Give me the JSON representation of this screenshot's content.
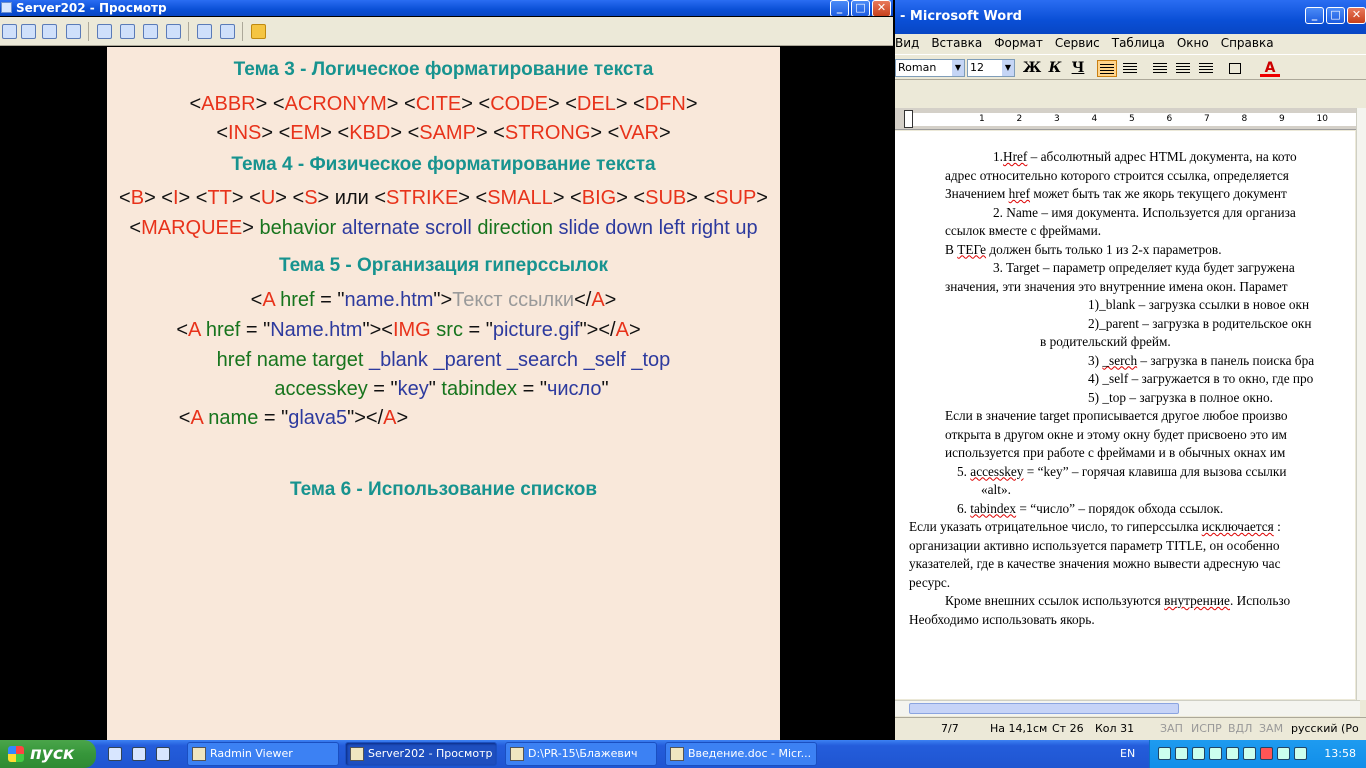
{
  "left_window": {
    "title": "Server202 - Просмотр",
    "controls": {
      "minimize": "_",
      "maximize": "□",
      "close": "✕"
    },
    "slide": {
      "lines": [
        {
          "kind": "head",
          "parts": [
            {
              "t": "Тема 3 - Логическое форматирование текста",
              "c": "head"
            }
          ]
        },
        {
          "kind": "code",
          "parts": [
            {
              "t": "<",
              "c": "k"
            },
            {
              "t": "ABBR",
              "c": "r"
            },
            {
              "t": "> <",
              "c": "k"
            },
            {
              "t": "ACRONYM",
              "c": "r"
            },
            {
              "t": "> <",
              "c": "k"
            },
            {
              "t": "CITE",
              "c": "r"
            },
            {
              "t": "> <",
              "c": "k"
            },
            {
              "t": "CODE",
              "c": "r"
            },
            {
              "t": "> <",
              "c": "k"
            },
            {
              "t": "DEL",
              "c": "r"
            },
            {
              "t": "> <",
              "c": "k"
            },
            {
              "t": "DFN",
              "c": "r"
            },
            {
              "t": ">",
              "c": "k"
            }
          ]
        },
        {
          "kind": "code",
          "parts": [
            {
              "t": "<",
              "c": "k"
            },
            {
              "t": "INS",
              "c": "r"
            },
            {
              "t": "> <",
              "c": "k"
            },
            {
              "t": "EM",
              "c": "r"
            },
            {
              "t": "> <",
              "c": "k"
            },
            {
              "t": "KBD",
              "c": "r"
            },
            {
              "t": "> <",
              "c": "k"
            },
            {
              "t": "SAMP",
              "c": "r"
            },
            {
              "t": "> <",
              "c": "k"
            },
            {
              "t": "STRONG",
              "c": "r"
            },
            {
              "t": "> <",
              "c": "k"
            },
            {
              "t": "VAR",
              "c": "r"
            },
            {
              "t": ">",
              "c": "k"
            }
          ]
        },
        {
          "kind": "head",
          "parts": [
            {
              "t": "Тема 4 - Физическое форматирование текста",
              "c": "head"
            }
          ]
        },
        {
          "kind": "code",
          "parts": [
            {
              "t": "<",
              "c": "k"
            },
            {
              "t": "B",
              "c": "r"
            },
            {
              "t": "> <",
              "c": "k"
            },
            {
              "t": "I",
              "c": "r"
            },
            {
              "t": "> <",
              "c": "k"
            },
            {
              "t": "TT",
              "c": "r"
            },
            {
              "t": "> <",
              "c": "k"
            },
            {
              "t": "U",
              "c": "r"
            },
            {
              "t": "> <",
              "c": "k"
            },
            {
              "t": "S",
              "c": "r"
            },
            {
              "t": "> или <",
              "c": "k"
            },
            {
              "t": "STRIKE",
              "c": "r"
            },
            {
              "t": "> <",
              "c": "k"
            },
            {
              "t": "SMALL",
              "c": "r"
            },
            {
              "t": "> <",
              "c": "k"
            },
            {
              "t": "BIG",
              "c": "r"
            },
            {
              "t": "> <",
              "c": "k"
            },
            {
              "t": "SUB",
              "c": "r"
            },
            {
              "t": "> <",
              "c": "k"
            },
            {
              "t": "SUP",
              "c": "r"
            },
            {
              "t": ">",
              "c": "k"
            }
          ]
        },
        {
          "kind": "code",
          "parts": [
            {
              "t": "<",
              "c": "k"
            },
            {
              "t": "MARQUEE",
              "c": "r"
            },
            {
              "t": "> ",
              "c": "k"
            },
            {
              "t": "behavior ",
              "c": "g"
            },
            {
              "t": "alternate ",
              "c": "b"
            },
            {
              "t": "scroll ",
              "c": "b"
            },
            {
              "t": "direction ",
              "c": "g"
            },
            {
              "t": "slide ",
              "c": "b"
            },
            {
              "t": "down ",
              "c": "b"
            },
            {
              "t": "left ",
              "c": "b"
            },
            {
              "t": "right ",
              "c": "b"
            },
            {
              "t": "up",
              "c": "b"
            }
          ]
        },
        {
          "kind": "head",
          "parts": [
            {
              "t": "Тема 5 - Организация гиперссылок",
              "c": "head"
            }
          ]
        },
        {
          "kind": "code",
          "parts": [
            {
              "t": "<",
              "c": "k"
            },
            {
              "t": "A ",
              "c": "r"
            },
            {
              "t": "href",
              "c": "g"
            },
            {
              "t": " = \"",
              "c": "k"
            },
            {
              "t": "name.htm",
              "c": "b"
            },
            {
              "t": "\">",
              "c": "k"
            },
            {
              "t": "Текст ссылки",
              "c": "gy"
            },
            {
              "t": "</",
              "c": "k"
            },
            {
              "t": "A",
              "c": "r"
            },
            {
              "t": ">",
              "c": "k"
            }
          ]
        },
        {
          "kind": "code",
          "parts": [
            {
              "t": "<",
              "c": "k"
            },
            {
              "t": "A ",
              "c": "r"
            },
            {
              "t": "href",
              "c": "g"
            },
            {
              "t": " = \"",
              "c": "k"
            },
            {
              "t": "Name.htm",
              "c": "b"
            },
            {
              "t": "\"><",
              "c": "k"
            },
            {
              "t": "IMG ",
              "c": "r"
            },
            {
              "t": "src",
              "c": "g"
            },
            {
              "t": " = \"",
              "c": "k"
            },
            {
              "t": "picture.gif",
              "c": "b"
            },
            {
              "t": "\"></",
              "c": "k"
            },
            {
              "t": "A",
              "c": "r"
            },
            {
              "t": ">",
              "c": "k"
            }
          ]
        },
        {
          "kind": "code",
          "parts": [
            {
              "t": "href  name  target  ",
              "c": "g"
            },
            {
              "t": "_blank  _parent  _search  _self  _top",
              "c": "b"
            }
          ]
        },
        {
          "kind": "code",
          "parts": [
            {
              "t": "accesskey",
              "c": "g"
            },
            {
              "t": " = \"",
              "c": "k"
            },
            {
              "t": "key",
              "c": "b"
            },
            {
              "t": "\" ",
              "c": "k"
            },
            {
              "t": "tabindex",
              "c": "g"
            },
            {
              "t": " = \"",
              "c": "k"
            },
            {
              "t": "число",
              "c": "b"
            },
            {
              "t": "\"",
              "c": "k"
            }
          ]
        },
        {
          "kind": "code",
          "parts": [
            {
              "t": "<",
              "c": "k"
            },
            {
              "t": "A ",
              "c": "r"
            },
            {
              "t": "name",
              "c": "g"
            },
            {
              "t": " = \"",
              "c": "k"
            },
            {
              "t": "glava5",
              "c": "b"
            },
            {
              "t": "\"></",
              "c": "k"
            },
            {
              "t": "A",
              "c": "r"
            },
            {
              "t": ">",
              "c": "k"
            }
          ]
        },
        {
          "kind": "head",
          "parts": [
            {
              "t": "Тема 6 - Использование списков",
              "c": "head"
            }
          ]
        }
      ]
    }
  },
  "right_window": {
    "title": "- Microsoft Word",
    "controls": {
      "minimize": "_",
      "maximize": "□",
      "close": "✕"
    },
    "menu": [
      "Вид",
      "Вставка",
      "Формат",
      "Сервис",
      "Таблица",
      "Окно",
      "Справка"
    ],
    "font_name": "Roman",
    "font_size": "12",
    "format_buttons": {
      "bold": "Ж",
      "italic": "К",
      "underline": "Ч",
      "font_color": "A"
    },
    "ruler_numbers": [
      "1",
      "2",
      "3",
      "4",
      "5",
      "6",
      "7",
      "8",
      "9",
      "10"
    ],
    "document_lines": [
      [
        {
          "t": "1."
        },
        {
          "t": "Href",
          "u": true
        },
        {
          "t": " – абсолютный адрес HTML документа, на кото"
        }
      ],
      [
        {
          "t": "адрес относительно которого строится ссылка, определяется"
        }
      ],
      [
        {
          "t": "Значением "
        },
        {
          "t": "href",
          "u": true
        },
        {
          "t": " может быть так же якорь текущего документ"
        }
      ],
      [
        {
          "t": "2. Name – имя документа. Используется для организа"
        }
      ],
      [
        {
          "t": "ссылок вместе с фреймами."
        }
      ],
      [
        {
          "t": "В "
        },
        {
          "t": "ТЕГе",
          "u": true
        },
        {
          "t": " должен быть только 1 из 2-х параметров."
        }
      ],
      [
        {
          "t": "3. Target – параметр определяет куда будет загружена"
        }
      ],
      [
        {
          "t": "значения, эти значения это внутренние имена окон. Парамет"
        }
      ],
      [
        {
          "t": "1)_blank – загрузка ссылки в новое окн"
        }
      ],
      [
        {
          "t": "2)_parent – загрузка в родительское окн"
        }
      ],
      [
        {
          "t": "в родительский фрейм."
        }
      ],
      [
        {
          "t": "3) "
        },
        {
          "t": "_serch",
          "u": true
        },
        {
          "t": " – загрузка в панель поиска бра"
        }
      ],
      [
        {
          "t": "4) _self – загружается в то окно, где про"
        }
      ],
      [
        {
          "t": "5) _top – загрузка в полное окно."
        }
      ],
      [
        {
          "t": "Если в значение target прописывается другое любое произво"
        }
      ],
      [
        {
          "t": "открыта в другом окне и этому окну будет присвоено это им"
        }
      ],
      [
        {
          "t": "используется при работе с фреймами и в обычных окнах им"
        }
      ],
      [
        {
          "t": "5.     "
        },
        {
          "t": "accesskey",
          "u": true
        },
        {
          "t": " = “key” – горячая клавиша для вызова ссылки"
        }
      ],
      [
        {
          "t": "«alt»."
        }
      ],
      [
        {
          "t": "6.     "
        },
        {
          "t": "tabindex",
          "u": true
        },
        {
          "t": " = “число” – порядок обхода ссылок."
        }
      ],
      [
        {
          "t": " Если указать отрицательное число, то гиперссылка "
        },
        {
          "t": "исключается",
          "u": true
        },
        {
          "t": " :"
        }
      ],
      [
        {
          "t": "организации активно используется параметр TITLE, он особенно"
        }
      ],
      [
        {
          "t": "указателей, где в качестве значения можно вывести адресную час"
        }
      ],
      [
        {
          "t": "ресурс."
        }
      ],
      [
        {
          "t": "Кроме внешних ссылок используются "
        },
        {
          "t": "внутренние",
          "u": true
        },
        {
          "t": ". Использо"
        }
      ],
      [
        {
          "t": "Необходимо использовать якорь."
        }
      ]
    ],
    "status": {
      "page": "7/7",
      "position": "На 14,1см",
      "line": "Ст 26",
      "column": "Кол 31",
      "rec": "ЗАП",
      "trk": "ИСПР",
      "ext": "ВДЛ",
      "ovr": "ЗАМ",
      "language": "русский (Ро"
    }
  },
  "taskbar": {
    "start_label": "пуск",
    "tasks": [
      {
        "label": "Radmin Viewer",
        "active": false
      },
      {
        "label": "Server202 - Просмотр",
        "active": true
      },
      {
        "label": "D:\\PR-15\\Блажевич",
        "active": false
      },
      {
        "label": "Введение.doc - Micr...",
        "active": false
      }
    ],
    "language": "EN",
    "clock": "13:58"
  }
}
